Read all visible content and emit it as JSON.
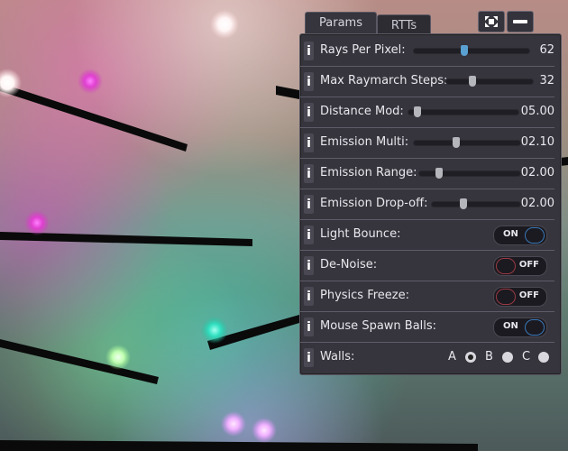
{
  "tabs": [
    {
      "label": "Params",
      "active": true
    },
    {
      "label": "RTTs",
      "active": false
    }
  ],
  "top_buttons": [
    {
      "icon": "expand-icon"
    },
    {
      "icon": "minimize-icon"
    }
  ],
  "sliders": [
    {
      "label": "Rays Per Pixel:",
      "value": "62",
      "fraction": 0.44
    },
    {
      "label": "Max Raymarch Steps:",
      "value": "32",
      "fraction": 0.3
    },
    {
      "label": "Distance Mod:",
      "value": "05.00",
      "fraction": 0.08
    },
    {
      "label": "Emission Multi:",
      "value": "02.10",
      "fraction": 0.4
    },
    {
      "label": "Emission Range:",
      "value": "02.00",
      "fraction": 0.2
    },
    {
      "label": "Emission Drop-off:",
      "value": "02.00",
      "fraction": 0.36
    }
  ],
  "toggles": [
    {
      "label": "Light Bounce:",
      "state": "ON"
    },
    {
      "label": "De-Noise:",
      "state": "OFF"
    },
    {
      "label": "Physics Freeze:",
      "state": "OFF"
    },
    {
      "label": "Mouse Spawn Balls:",
      "state": "ON"
    }
  ],
  "walls": {
    "label": "Walls:",
    "options": [
      "A",
      "B",
      "C"
    ],
    "selected": "A"
  },
  "info_glyph": "i",
  "colors": {
    "panel_bg": "#36343c",
    "toggle_on_ring": "#3a78b8",
    "toggle_off_ring": "#9a3a44",
    "active_knob": "#5aa0d0"
  }
}
